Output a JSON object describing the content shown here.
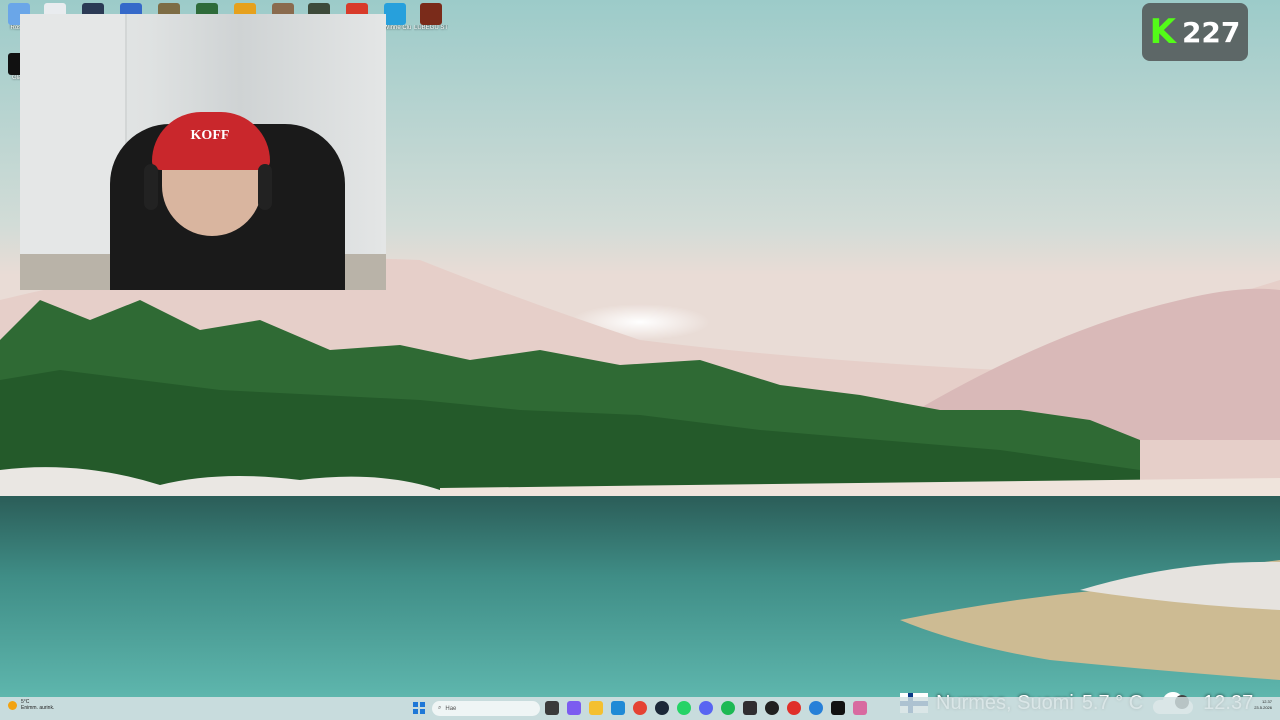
{
  "desktop": {
    "icons": [
      {
        "name": "recycle-bin-icon",
        "label": "Roska",
        "color": "#6aa6e8"
      },
      {
        "name": "app-icon-2",
        "label": "",
        "color": "#e9ecef"
      },
      {
        "name": "app-icon-3",
        "label": "",
        "color": "#2b3a55"
      },
      {
        "name": "app-icon-4",
        "label": "",
        "color": "#3569c9"
      },
      {
        "name": "app-icon-5",
        "label": "",
        "color": "#7d6d45"
      },
      {
        "name": "app-icon-6",
        "label": "",
        "color": "#2e6b3a"
      },
      {
        "name": "app-icon-7",
        "label": "",
        "color": "#e6a11d"
      },
      {
        "name": "app-icon-8",
        "label": "",
        "color": "#8a6b4e"
      },
      {
        "name": "app-icon-9",
        "label": "",
        "color": "#3d4a3a"
      },
      {
        "name": "app-icon-10",
        "label": "",
        "color": "#d83b2a"
      },
      {
        "name": "app-icon-11",
        "label": "ryWinne Clu",
        "color": "#27a0dc"
      },
      {
        "name": "app-icon-12",
        "label": "LÜBEGÜ ST",
        "color": "#7a2b1a"
      }
    ],
    "second_row_icon": {
      "label": "Gladi",
      "color": "#111111"
    }
  },
  "webcam": {
    "cap_text": "KOFF"
  },
  "viewer_badge": {
    "logo": "K",
    "count": "227",
    "logo_color": "#53fc18"
  },
  "overlay": {
    "location": "Nurmes, Suomi",
    "temperature": "5.7 ° C",
    "time": "12.37"
  },
  "taskbar": {
    "weather_temp": "5°C",
    "weather_desc": "Enimm. aurink.",
    "search_placeholder": "Hae",
    "apps": [
      {
        "name": "task-view-icon",
        "color": "#3a3a3a"
      },
      {
        "name": "copilot-icon",
        "color": "#7b5cf0"
      },
      {
        "name": "file-explorer-icon",
        "color": "#f4c02f"
      },
      {
        "name": "edge-icon",
        "color": "#1f8ad6"
      },
      {
        "name": "chrome-icon",
        "color": "#e54334"
      },
      {
        "name": "steam-icon",
        "color": "#1b2838"
      },
      {
        "name": "whatsapp-icon",
        "color": "#25d366"
      },
      {
        "name": "discord-icon",
        "color": "#5865f2"
      },
      {
        "name": "spotify-icon",
        "color": "#1db954"
      },
      {
        "name": "obs-icon",
        "color": "#302e31"
      },
      {
        "name": "app-k-icon",
        "color": "#202020"
      },
      {
        "name": "app-red-icon",
        "color": "#e0302a"
      },
      {
        "name": "app-blue-icon",
        "color": "#2680d8"
      },
      {
        "name": "capcut-icon",
        "color": "#111111"
      },
      {
        "name": "app-pink-icon",
        "color": "#d86aa0"
      }
    ],
    "tray_time": "12.37",
    "tray_date": "23.5.2026"
  }
}
